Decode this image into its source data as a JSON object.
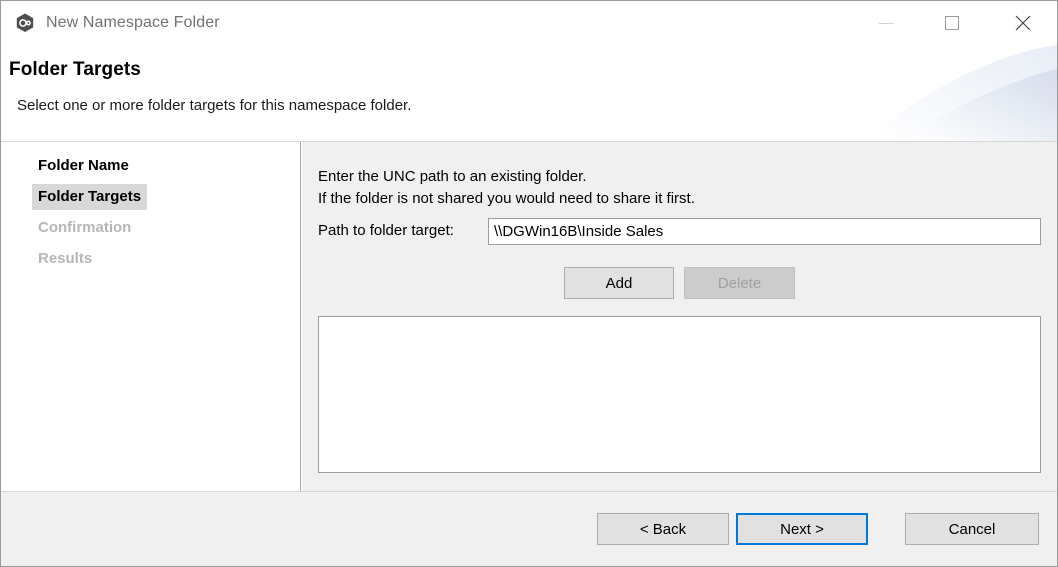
{
  "window": {
    "title": "New Namespace Folder",
    "icon": "namespace-folder-icon",
    "controls": {
      "minimize": "minimize-icon",
      "maximize": "maximize-icon",
      "close": "close-icon"
    }
  },
  "header": {
    "title": "Folder Targets",
    "subtitle": "Select one or more folder targets for this namespace folder."
  },
  "sidebar": {
    "items": [
      {
        "label": "Folder Name",
        "state": "done"
      },
      {
        "label": "Folder Targets",
        "state": "current"
      },
      {
        "label": "Confirmation",
        "state": "disabled"
      },
      {
        "label": "Results",
        "state": "disabled"
      }
    ]
  },
  "content": {
    "instruction_line1": "Enter the UNC path to an existing folder.",
    "instruction_line2": "If the folder is not shared you would need to share it first.",
    "path_label": "Path to folder target:",
    "path_value": "\\\\DGWin16B\\Inside Sales",
    "path_placeholder": "",
    "add_label": "Add",
    "delete_label": "Delete",
    "target_list_items": []
  },
  "footer": {
    "back_label": "< Back",
    "next_label": "Next >",
    "cancel_label": "Cancel"
  },
  "colors": {
    "accent": "#0078d7",
    "content_bg": "#f0f0f0",
    "button_bg": "#e1e1e1",
    "disabled_text": "#a0a0a0",
    "nav_highlight": "#d8d8d8",
    "title_text": "#727272"
  }
}
